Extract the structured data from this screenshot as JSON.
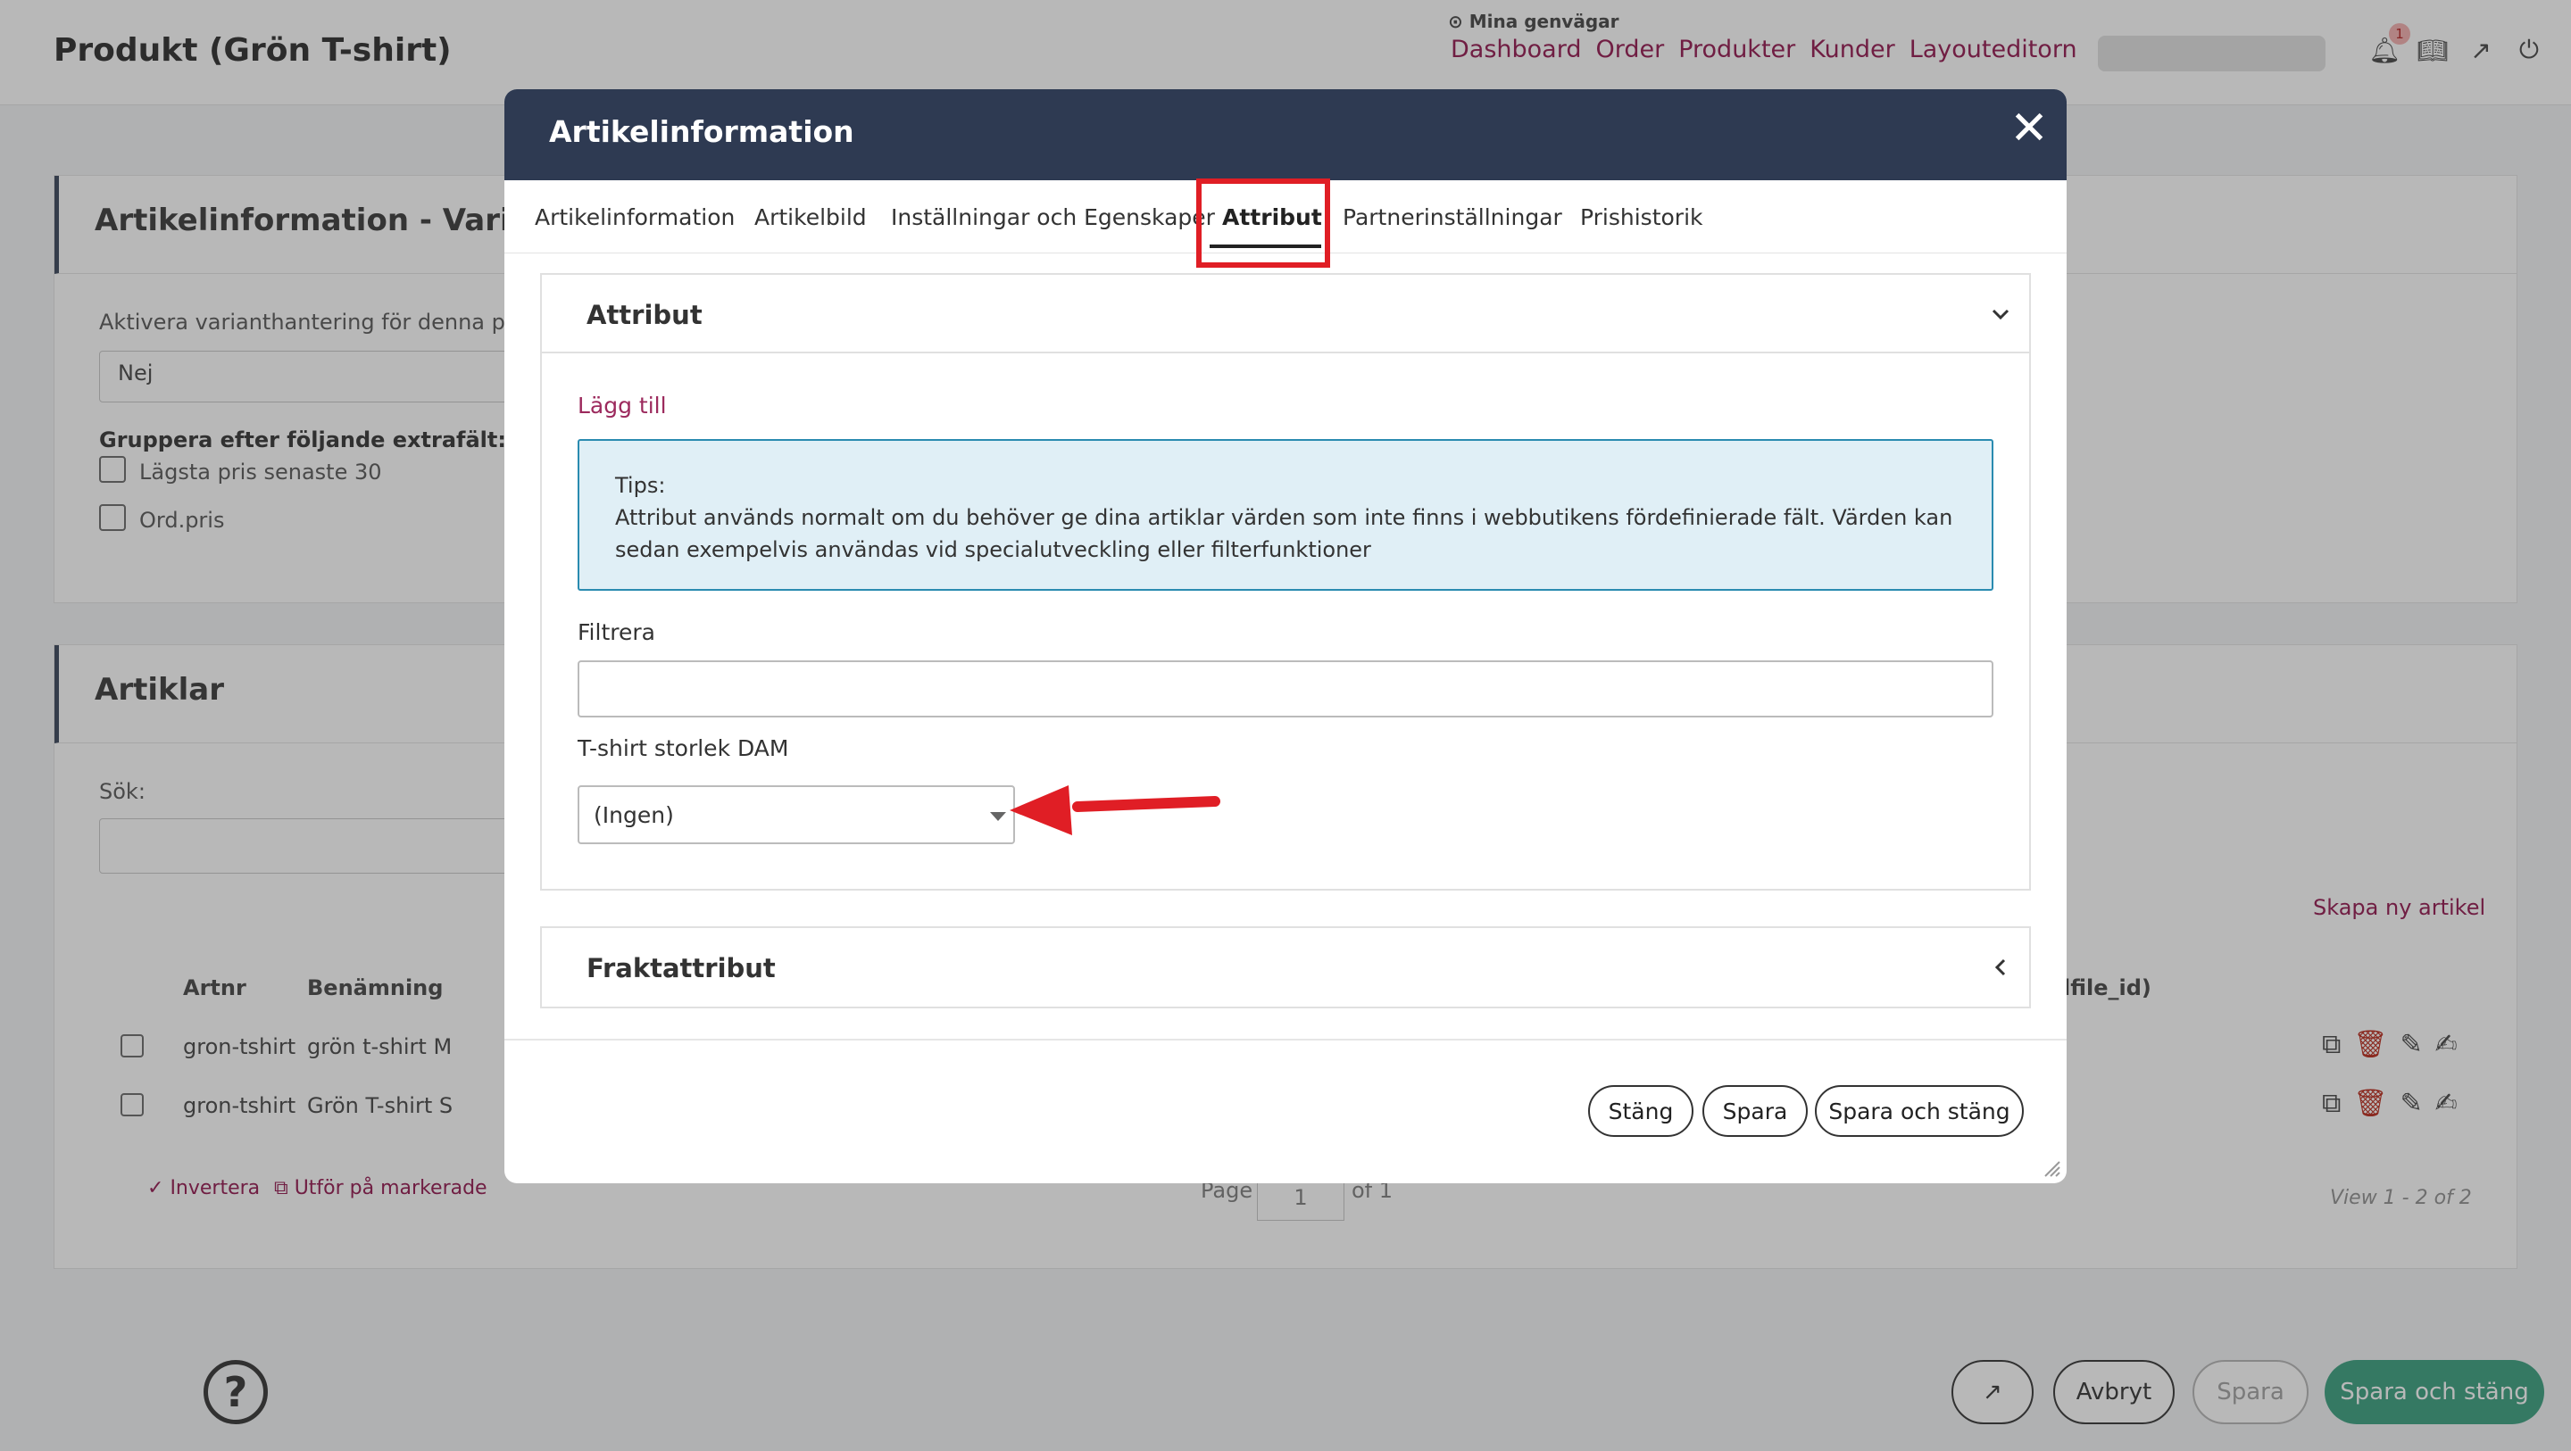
{
  "page": {
    "title": "Produkt (Grön T-shirt)",
    "shortcuts_label": "Mina genvägar",
    "shortcuts": [
      "Dashboard",
      "Order",
      "Produkter",
      "Kunder",
      "Layouteditorn"
    ],
    "notification_count": "1"
  },
  "variant_panel": {
    "title": "Artikelinformation - Varianth",
    "activate_label": "Aktivera varianthantering för denna pro",
    "activate_value": "Nej",
    "group_label": "Gruppera efter följande extrafält:",
    "check1": "Lägsta pris senaste 30",
    "check2": "Ord.pris"
  },
  "articles_panel": {
    "title": "Artiklar",
    "search_label": "Sök:",
    "create_link": "Skapa ny artikel",
    "columns": [
      "Artnr",
      "Benämning",
      "lfile_id)"
    ],
    "rows": [
      {
        "artnr": "gron-tshirt",
        "name": "grön t-shirt M"
      },
      {
        "artnr": "gron-tshirt",
        "name": "Grön T-shirt S"
      }
    ],
    "invert": "Invertera",
    "bulk": "Utför på markerade",
    "page_label": "Page",
    "page_value": "1",
    "page_of": "of 1",
    "view_info": "View 1 - 2 of 2"
  },
  "bottom_buttons": {
    "cancel": "Avbryt",
    "save": "Spara",
    "save_close": "Spara och stäng"
  },
  "modal": {
    "title": "Artikelinformation",
    "tabs": [
      "Artikelinformation",
      "Artikelbild",
      "Inställningar och Egenskaper",
      "Attribut",
      "Partnerinställningar",
      "Prishistorik"
    ],
    "active_tab": "Attribut",
    "attribut_section": {
      "title": "Attribut",
      "add_link": "Lägg till",
      "tips_title": "Tips:",
      "tips_text": "Attribut används normalt om du behöver ge dina artiklar värden som inte finns i webbutikens fördefinierade fält. Värden kan sedan exempelvis användas vid specialutveckling eller filterfunktioner",
      "filter_label": "Filtrera",
      "filter_value": "",
      "select_label": "T-shirt storlek DAM",
      "select_value": "(Ingen)"
    },
    "frakt_section": {
      "title": "Fraktattribut"
    },
    "buttons": {
      "close": "Stäng",
      "save": "Spara",
      "save_close": "Spara och stäng"
    }
  },
  "colors": {
    "header": "#2e3a52",
    "link": "#9c2a5d",
    "highlight": "#e01e25",
    "tips_bg": "#e0eff6",
    "tips_border": "#2a8bb0"
  }
}
